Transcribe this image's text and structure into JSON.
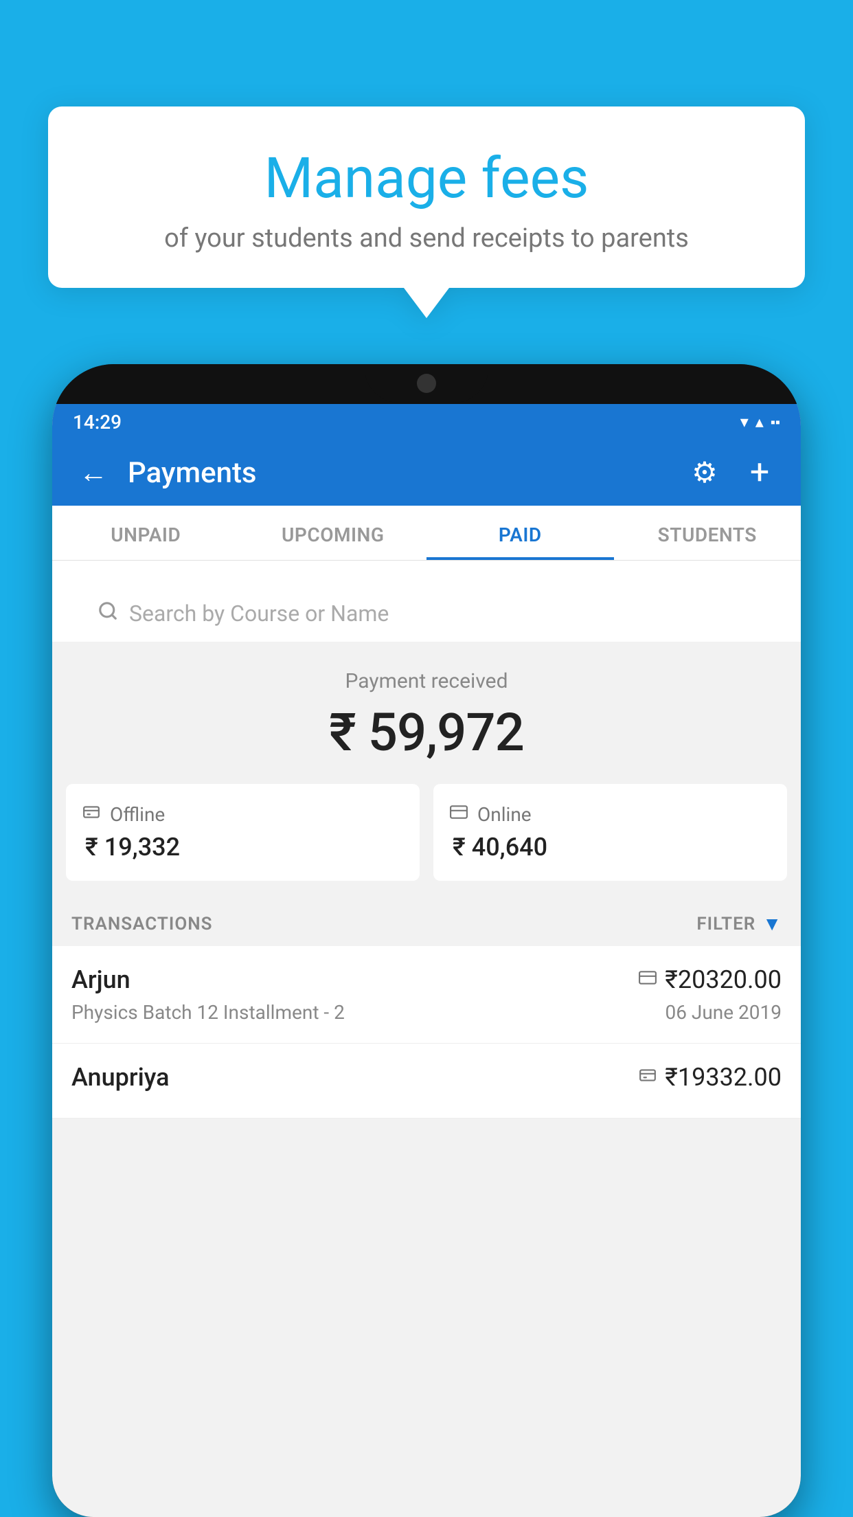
{
  "tooltip": {
    "title": "Manage fees",
    "subtitle": "of your students and send receipts to parents"
  },
  "statusBar": {
    "time": "14:29",
    "wifi_icon": "▼",
    "signal_icon": "▲",
    "battery_icon": "▪"
  },
  "header": {
    "title": "Payments",
    "back_icon": "←",
    "gear_icon": "⚙",
    "plus_icon": "+"
  },
  "tabs": [
    {
      "label": "UNPAID",
      "active": false
    },
    {
      "label": "UPCOMING",
      "active": false
    },
    {
      "label": "PAID",
      "active": true
    },
    {
      "label": "STUDENTS",
      "active": false
    }
  ],
  "search": {
    "placeholder": "Search by Course or Name"
  },
  "payment": {
    "received_label": "Payment received",
    "total_amount": "₹ 59,972",
    "offline_label": "Offline",
    "offline_amount": "₹ 19,332",
    "online_label": "Online",
    "online_amount": "₹ 40,640"
  },
  "transactions_header": "TRANSACTIONS",
  "filter_label": "FILTER",
  "transactions": [
    {
      "name": "Arjun",
      "course": "Physics Batch 12 Installment - 2",
      "amount": "₹20320.00",
      "date": "06 June 2019",
      "type": "online"
    },
    {
      "name": "Anupriya",
      "course": "",
      "amount": "₹19332.00",
      "date": "",
      "type": "offline"
    }
  ]
}
